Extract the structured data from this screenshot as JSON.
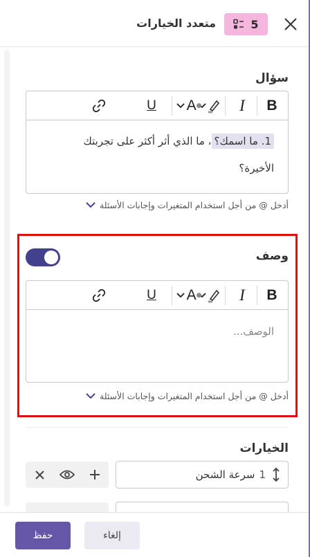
{
  "header": {
    "title": "متعدد الخيارات",
    "badge_number": "5",
    "close_icon": "close-icon",
    "badge_icon": "multiple-choice-icon",
    "badge_color": "#f4b6dd"
  },
  "question": {
    "label": "سؤال",
    "highlighted_text": "1. ما اسمك؟",
    "rest_text": "، ما الذي أثر أكثر على تجربتك",
    "second_line": "الأخيرة؟",
    "hint": "أدخل @ من أجل استخدام المتغيرات وإجابات الأسئلة"
  },
  "description": {
    "label": "وصف",
    "placeholder": "الوصف...",
    "hint": "أدخل @ من أجل استخدام المتغيرات وإجابات الأسئلة",
    "toggle_on": true,
    "frame_color": "#e01010"
  },
  "toolbar": {
    "items": [
      "bold-icon",
      "italic-icon",
      "highlight-icon",
      "font-color-icon",
      "underline-icon",
      "link-icon"
    ]
  },
  "options": {
    "label": "الخيارات",
    "items": [
      {
        "index": "1",
        "value": "سرعة الشحن"
      }
    ]
  },
  "footer": {
    "save_label": "حفظ",
    "cancel_label": "إلغاء",
    "accent": "#6656a8"
  }
}
